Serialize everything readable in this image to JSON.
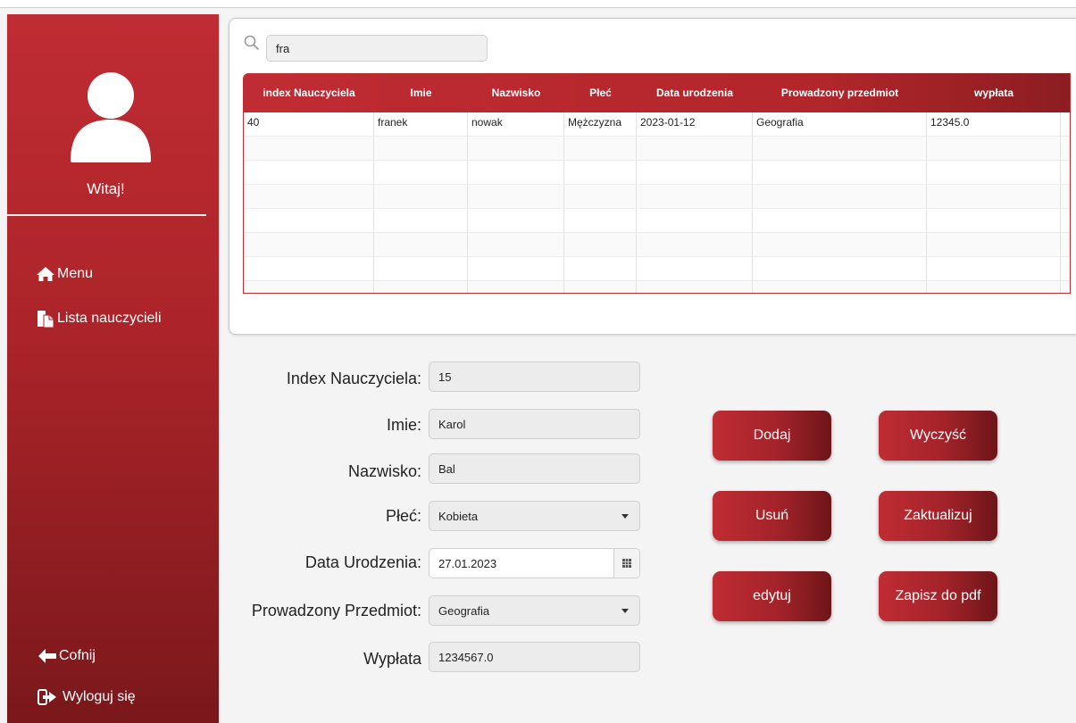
{
  "sidebar": {
    "welcome": "Witaj!",
    "menu_label": "Menu",
    "list_label": "Lista nauczycieli",
    "back_label": "Cofnij",
    "logout_label": "Wyloguj się"
  },
  "search": {
    "value": "fra"
  },
  "table": {
    "headers": [
      "index Nauczyciela",
      "Imie",
      "Nazwisko",
      "Płeć",
      "Data urodzenia",
      "Prowadzony przedmiot",
      "wypłata"
    ],
    "rows": [
      [
        "40",
        "franek",
        "nowak",
        "Mężczyzna",
        "2023-01-12",
        "Geografia",
        "12345.0"
      ]
    ]
  },
  "form": {
    "index_label": "Index Nauczyciela:",
    "index_value": "15",
    "imie_label": "Imie:",
    "imie_value": "Karol",
    "nazwisko_label": "Nazwisko:",
    "nazwisko_value": "Bal",
    "plec_label": "Płeć:",
    "plec_value": "Kobieta",
    "data_label": "Data Urodzenia:",
    "data_value": "27.01.2023",
    "przedmiot_label": "Prowadzony Przedmiot:",
    "przedmiot_value": "Geografia",
    "wyplata_label": "Wypłata",
    "wyplata_value": "1234567.0"
  },
  "buttons": {
    "dodaj": "Dodaj",
    "wyczysc": "Wyczyść",
    "usun": "Usuń",
    "zaktualizuj": "Zaktualizuj",
    "edytuj": "edytuj",
    "pdf": "Zapisz do pdf"
  },
  "colors": {
    "accent": "#c02c33",
    "accent_dark": "#6e1519"
  }
}
